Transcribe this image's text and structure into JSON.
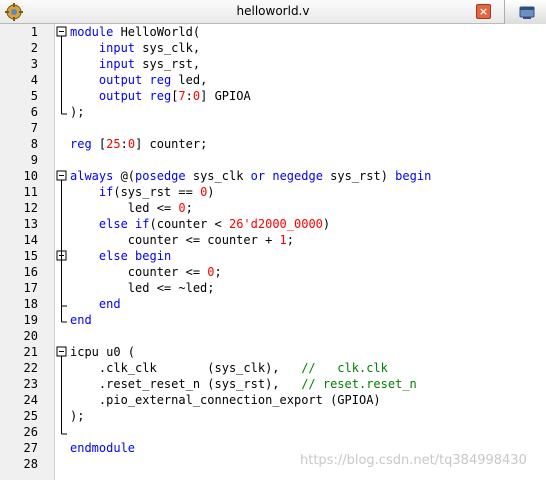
{
  "window": {
    "title": "helloworld.v",
    "close_glyph": "×"
  },
  "icons": {
    "app": "quartus-file-icon",
    "close": "close-icon",
    "dock": "dock-window-icon"
  },
  "lines": [
    {
      "n": "1",
      "t": [
        [
          "kw",
          "module"
        ],
        [
          "p",
          " HelloWorld("
        ]
      ],
      "fold": "open"
    },
    {
      "n": "2",
      "t": [
        [
          "p",
          "    "
        ],
        [
          "kw",
          "input"
        ],
        [
          "p",
          " sys_clk,"
        ]
      ]
    },
    {
      "n": "3",
      "t": [
        [
          "p",
          "    "
        ],
        [
          "kw",
          "input"
        ],
        [
          "p",
          " sys_rst,"
        ]
      ]
    },
    {
      "n": "4",
      "t": [
        [
          "p",
          "    "
        ],
        [
          "kw",
          "output"
        ],
        [
          "p",
          " "
        ],
        [
          "kw",
          "reg"
        ],
        [
          "p",
          " led,"
        ]
      ]
    },
    {
      "n": "5",
      "t": [
        [
          "p",
          "    "
        ],
        [
          "kw",
          "output"
        ],
        [
          "p",
          " "
        ],
        [
          "kw",
          "reg"
        ],
        [
          "p",
          "["
        ],
        [
          "num",
          "7"
        ],
        [
          "p",
          ":"
        ],
        [
          "num",
          "0"
        ],
        [
          "p",
          "] GPIOA"
        ]
      ]
    },
    {
      "n": "6",
      "t": [
        [
          "p",
          ");"
        ]
      ],
      "fold": "end"
    },
    {
      "n": "7",
      "t": []
    },
    {
      "n": "8",
      "t": [
        [
          "kw",
          "reg"
        ],
        [
          "p",
          " ["
        ],
        [
          "num",
          "25"
        ],
        [
          "p",
          ":"
        ],
        [
          "num",
          "0"
        ],
        [
          "p",
          "] counter;"
        ]
      ]
    },
    {
      "n": "9",
      "t": []
    },
    {
      "n": "10",
      "t": [
        [
          "kw",
          "always"
        ],
        [
          "p",
          " @("
        ],
        [
          "kw",
          "posedge"
        ],
        [
          "p",
          " sys_clk "
        ],
        [
          "kw",
          "or"
        ],
        [
          "p",
          " "
        ],
        [
          "kw",
          "negedge"
        ],
        [
          "p",
          " sys_rst) "
        ],
        [
          "kw",
          "begin"
        ]
      ],
      "fold": "open"
    },
    {
      "n": "11",
      "t": [
        [
          "p",
          "    "
        ],
        [
          "kw",
          "if"
        ],
        [
          "p",
          "(sys_rst == "
        ],
        [
          "num",
          "0"
        ],
        [
          "p",
          ")"
        ]
      ]
    },
    {
      "n": "12",
      "t": [
        [
          "p",
          "        led <= "
        ],
        [
          "num",
          "0"
        ],
        [
          "p",
          ";"
        ]
      ]
    },
    {
      "n": "13",
      "t": [
        [
          "p",
          "    "
        ],
        [
          "kw",
          "else"
        ],
        [
          "p",
          " "
        ],
        [
          "kw",
          "if"
        ],
        [
          "p",
          "(counter < "
        ],
        [
          "num",
          "26'd2000_0000"
        ],
        [
          "p",
          ")"
        ]
      ]
    },
    {
      "n": "14",
      "t": [
        [
          "p",
          "        counter <= counter + "
        ],
        [
          "num",
          "1"
        ],
        [
          "p",
          ";"
        ]
      ]
    },
    {
      "n": "15",
      "t": [
        [
          "p",
          "    "
        ],
        [
          "kw",
          "else"
        ],
        [
          "p",
          " "
        ],
        [
          "kw",
          "begin"
        ]
      ],
      "fold": "open"
    },
    {
      "n": "16",
      "t": [
        [
          "p",
          "        counter <= "
        ],
        [
          "num",
          "0"
        ],
        [
          "p",
          ";"
        ]
      ]
    },
    {
      "n": "17",
      "t": [
        [
          "p",
          "        led <= ~led;"
        ]
      ]
    },
    {
      "n": "18",
      "t": [
        [
          "p",
          "    "
        ],
        [
          "kw",
          "end"
        ]
      ],
      "fold": "end"
    },
    {
      "n": "19",
      "t": [
        [
          "kw",
          "end"
        ]
      ],
      "fold": "end"
    },
    {
      "n": "20",
      "t": []
    },
    {
      "n": "21",
      "t": [
        [
          "p",
          "icpu u0 ("
        ]
      ],
      "fold": "open"
    },
    {
      "n": "22",
      "t": [
        [
          "p",
          "    .clk_clk       (sys_clk),   "
        ],
        [
          "cm",
          "//   clk.clk"
        ]
      ]
    },
    {
      "n": "23",
      "t": [
        [
          "p",
          "    .reset_reset_n (sys_rst),   "
        ],
        [
          "cm",
          "// reset.reset_n"
        ]
      ]
    },
    {
      "n": "24",
      "t": [
        [
          "p",
          "    .pio_external_connection_export (GPIOA)"
        ]
      ]
    },
    {
      "n": "25",
      "t": [
        [
          "p",
          ");"
        ]
      ]
    },
    {
      "n": "26",
      "t": [],
      "fold": "end"
    },
    {
      "n": "27",
      "t": [
        [
          "kw",
          "endmodule"
        ]
      ]
    },
    {
      "n": "28",
      "t": []
    }
  ],
  "watermark": "https://blog.csdn.net/tq384998430"
}
